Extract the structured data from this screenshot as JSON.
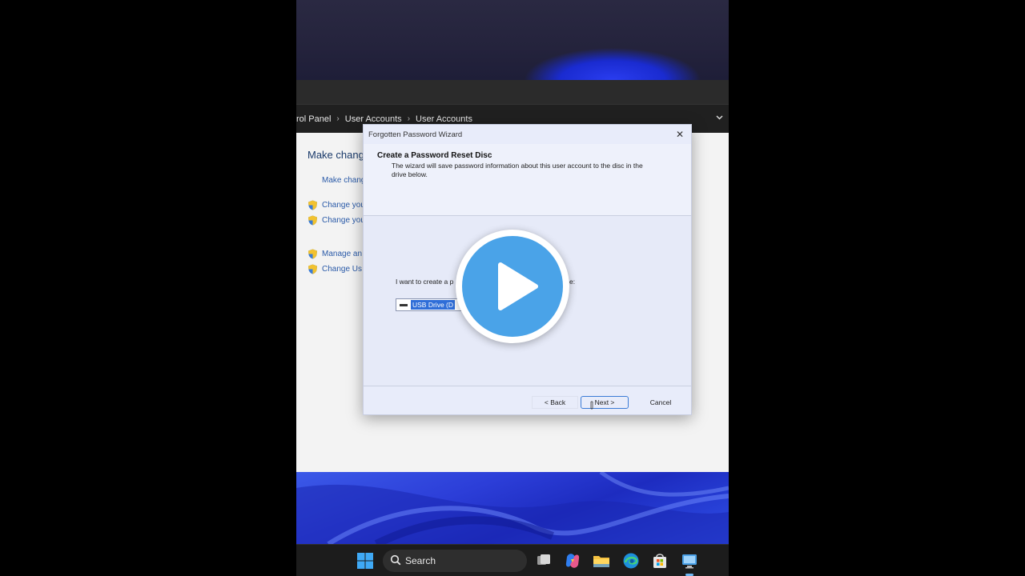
{
  "explorer": {
    "breadcrumbs": [
      "rol Panel",
      "User Accounts",
      "User Accounts"
    ]
  },
  "control_panel": {
    "heading": "Make chang",
    "links": [
      {
        "label": "Make chang",
        "shield": false
      },
      {
        "label": "Change you",
        "shield": true
      },
      {
        "label": "Change you",
        "shield": true
      },
      {
        "label": "Manage an",
        "shield": true
      },
      {
        "label": "Change Us",
        "shield": true
      }
    ]
  },
  "wizard": {
    "title": "Forgotten Password Wizard",
    "header_title": "Create a Password Reset Disc",
    "header_subtitle": "The wizard will save password information about this user account to the disc in the drive below.",
    "prompt_visible": "I want to create a p",
    "prompt_tail": "e:",
    "drive_selected": "USB Drive (D",
    "buttons": {
      "back": "< Back",
      "next": "Next >",
      "cancel": "Cancel"
    }
  },
  "taskbar": {
    "search_label": "Search"
  },
  "colors": {
    "accent": "#4aa3e8",
    "selection": "#2f6ed8",
    "link": "#2a5aa8"
  }
}
